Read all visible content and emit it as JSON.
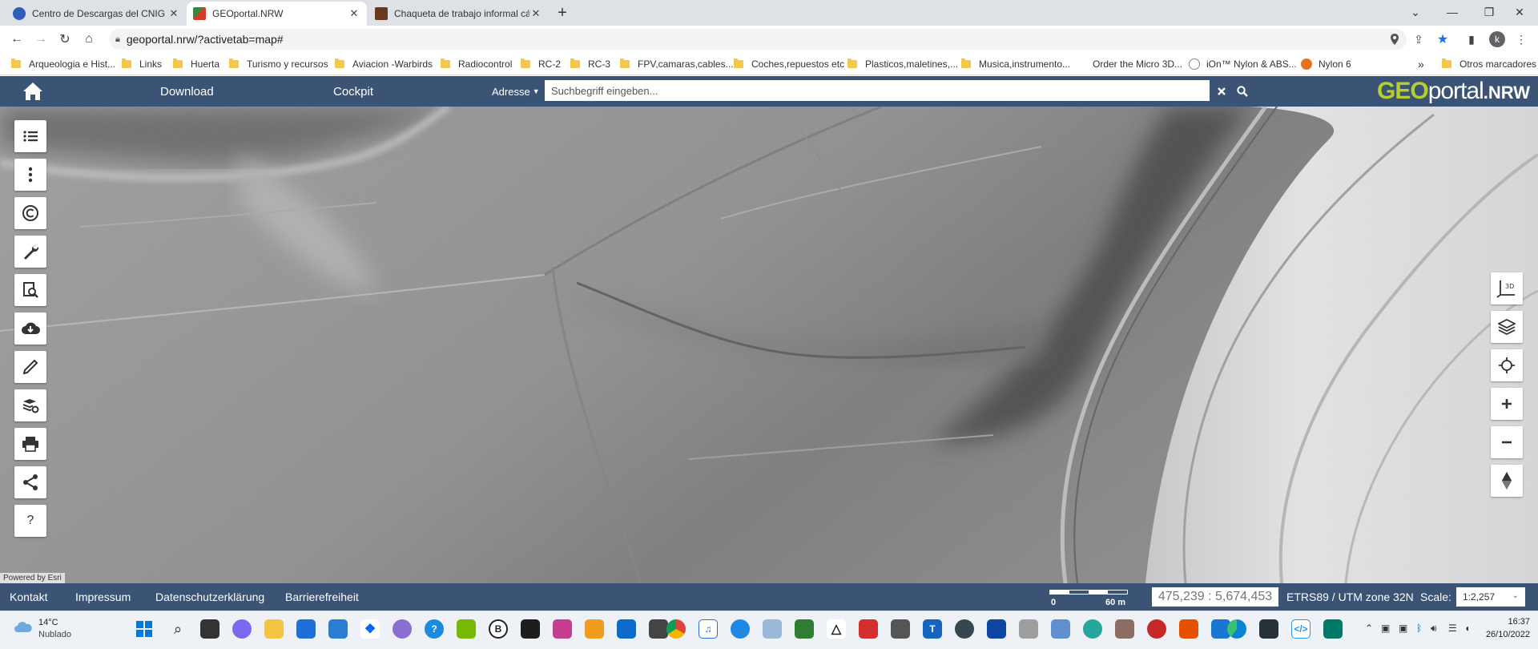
{
  "tabs": [
    {
      "title": "Centro de Descargas del CNIG (I",
      "favicon_color": "#2d5fb8",
      "active": false
    },
    {
      "title": "GEOportal.NRW",
      "favicon_color": "#d33b2f",
      "active": true
    },
    {
      "title": "Chaqueta de trabajo informal cá",
      "favicon_color": "#6b3a1e",
      "active": false
    }
  ],
  "address_bar": {
    "url": "geoportal.nrw/?activetab=map#"
  },
  "bookmarks": [
    {
      "label": "Arqueologia e Hist..."
    },
    {
      "label": "Links"
    },
    {
      "label": "Huerta"
    },
    {
      "label": "Turismo y recursos"
    },
    {
      "label": "Aviacion -Warbirds"
    },
    {
      "label": "Radiocontrol"
    },
    {
      "label": "RC-2"
    },
    {
      "label": "RC-3"
    },
    {
      "label": "FPV,camaras,cables..."
    },
    {
      "label": "Coches,repuestos etc"
    },
    {
      "label": "Plasticos,maletines,..."
    },
    {
      "label": "Musica,instrumento..."
    },
    {
      "label": "Order the Micro 3D..."
    },
    {
      "label": "iOn™ Nylon & ABS..."
    },
    {
      "label": "Nylon 6"
    }
  ],
  "bookmarks_more": "»",
  "other_bookmarks": "Otros marcadores",
  "header": {
    "download": "Download",
    "cockpit": "Cockpit",
    "address_dropdown": "Adresse",
    "search_placeholder": "Suchbegriff eingeben...",
    "logo_geo": "GEO",
    "logo_portal": "portal",
    "logo_nrw": ".NRW"
  },
  "map": {
    "powered_by": "Powered by Esri",
    "left_tools": [
      "list-icon",
      "more-vertical-icon",
      "copyright-icon",
      "wrench-icon",
      "search-document-icon",
      "cloud-download-icon",
      "pencil-icon",
      "layers-settings-icon",
      "printer-icon",
      "share-icon",
      "help-icon"
    ],
    "help_label": "?",
    "right_tools": [
      "3d-view-icon",
      "layers-icon",
      "locate-icon",
      "zoom-in-icon",
      "zoom-out-icon",
      "compass-icon"
    ],
    "view_3d_label": "3D"
  },
  "footer": {
    "links": [
      "Kontakt",
      "Impressum",
      "Datenschutzerklärung",
      "Barrierefreiheit"
    ],
    "scalebar_start": "0",
    "scalebar_end": "60 m",
    "coordinates": "475,239 : 5,674,453",
    "crs": "ETRS89 / UTM zone 32N",
    "scale_label": "Scale:",
    "scale_value": "1:2,257"
  },
  "taskbar": {
    "temperature": "14°C",
    "weather": "Nublado",
    "time": "16:37",
    "date": "26/10/2022"
  }
}
